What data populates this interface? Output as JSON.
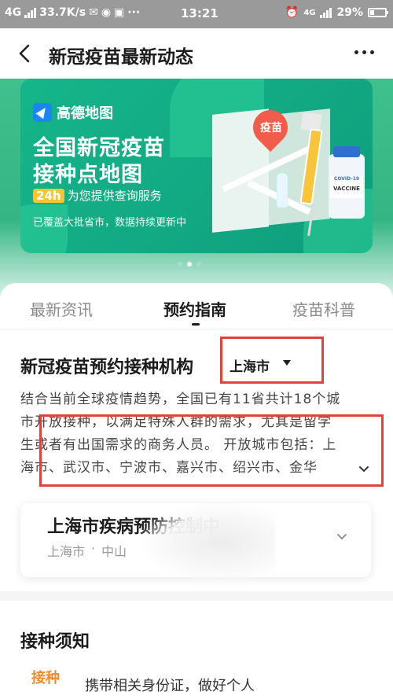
{
  "status_bar": {
    "network_type": "4G",
    "speed": "33.7K/s",
    "time": "13:21",
    "network_type_right": "4G",
    "battery": "29%"
  },
  "nav": {
    "title": "新冠疫苗最新动态",
    "icons": [
      "back-icon",
      "more-icon"
    ]
  },
  "banner": {
    "logo_text": "高德地图",
    "headline_line1": "全国新冠疫苗",
    "headline_line2": "接种点地图",
    "tag_24h": "24h",
    "subtitle": "为您提供查询服务",
    "note": "已覆盖大批省市，数据持续更新中",
    "pin_label": "疫苗",
    "vial_brand": "COVID-19",
    "vial_label": "VACCINE",
    "carousel_total": 3,
    "carousel_active": 2
  },
  "tabs": [
    {
      "label": "最新资讯",
      "active": false
    },
    {
      "label": "预约指南",
      "active": true
    },
    {
      "label": "疫苗科普",
      "active": false
    }
  ],
  "section": {
    "title": "新冠疫苗预约接种机构",
    "city": "上海市",
    "description_line1": "结合当前全球疫情趋势，全国已有11省共计18个城",
    "description_line2": "市开放接种，以满足特殊人群的需求，尤其是留学",
    "description_line3": "生或者有出国需求的商务人员。 开放城市包括：上",
    "description_line4": "海市、武汉市、宁波市、嘉兴市、绍兴市、金华"
  },
  "institution": {
    "name": "上海市疾病预防控制中",
    "city": "上海市",
    "separator": "·",
    "district": "中山"
  },
  "notice": {
    "title": "接种须知",
    "badge": "接种",
    "first_item": "携带相关身份证，做好个人"
  },
  "colors": {
    "brand_green": "#12a983",
    "highlight_red": "#e0423c",
    "accent_orange": "#f58a2c"
  }
}
